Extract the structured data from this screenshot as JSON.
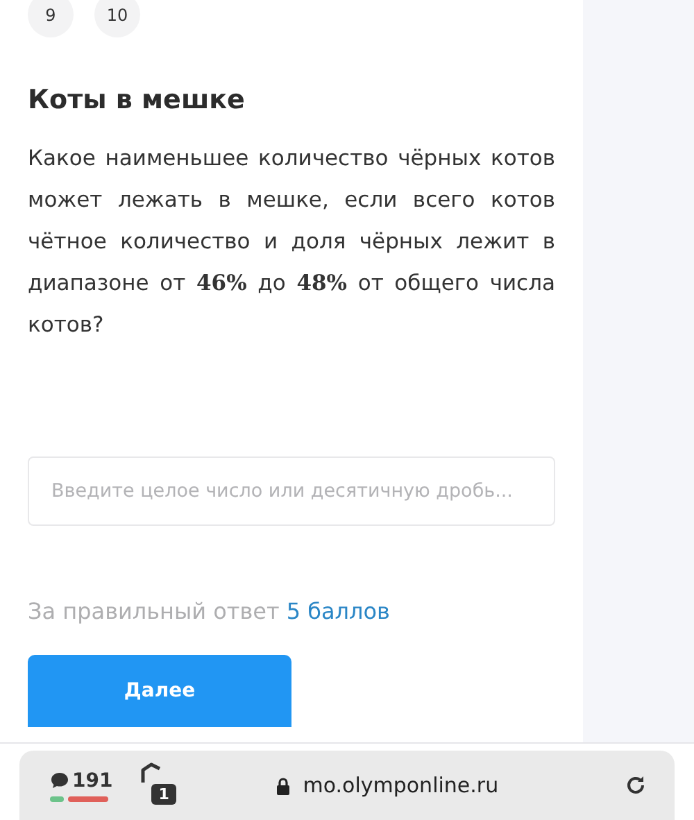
{
  "question_numbers": [
    {
      "label": "9"
    },
    {
      "label": "10"
    }
  ],
  "task": {
    "title": "Коты в мешке",
    "text": "Какое наименьшее количество чёрных котов может лежать в мешке, если всего котов чётное количество и доля чёрных лежит в диапазоне от **46%** до **48%** от общего числа котов?"
  },
  "answer": {
    "placeholder": "Введите целое число или десятичную дробь..."
  },
  "points": {
    "label": "За правильный ответ",
    "value": "5 баллов"
  },
  "next_button": "Далее",
  "browser_bar": {
    "comments": "191",
    "tabs": "1",
    "url": "mo.olymponline.ru"
  }
}
